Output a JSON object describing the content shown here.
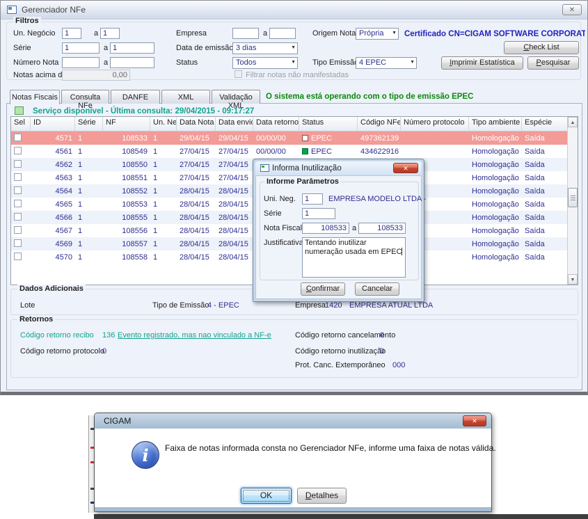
{
  "colors": {
    "teal_status": "#12a38f",
    "green_message": "#0b8a0b",
    "navy_value": "#2e2e90",
    "highlight_row_pink": "#f29b97",
    "certificate_blue": "#2222be",
    "status_green_box": "#00a550"
  },
  "main_window": {
    "title": "Gerenciador NFe",
    "filters": {
      "legend": "Filtros",
      "range_sep": "a",
      "un_negocio_label": "Un. Negócio",
      "un_negocio_from": "1",
      "un_negocio_to": "1",
      "serie_label": "Série",
      "serie_from": "1",
      "serie_to": "1",
      "numero_nota_label": "Número Nota",
      "numero_nota_from": "",
      "numero_nota_to": "",
      "notas_acima_label": "Notas acima de",
      "notas_acima_value": "0,00",
      "empresa_label": "Empresa",
      "empresa_from": "",
      "empresa_to": "",
      "data_emissao_label": "Data de emissão",
      "data_emissao_value": "3 dias",
      "status_label": "Status",
      "status_value": "Todos",
      "filtrar_label": "Filtrar notas não manifestadas",
      "origem_label": "Origem Nota",
      "origem_value": "Própria",
      "tipo_emissao_label": "Tipo Emissão",
      "tipo_emissao_value": "4 EPEC",
      "certificado": "Certificado CN=CIGAM SOFTWARE CORPORATIVI",
      "check_list_button": "Check List",
      "imprimir_button": "Imprimir Estatística",
      "pesquisar_button": "Pesquisar"
    },
    "tabs": {
      "items": [
        "Notas Fiscais",
        "Consulta NFe",
        "DANFE",
        "XML",
        "Validação XML"
      ],
      "active": "Notas Fiscais",
      "message": "O sistema está operando com o tipo de emissão EPEC"
    },
    "service_status": "Serviço disponível - Última consulta: 29/04/2015 - 09:17:27",
    "table": {
      "headers": [
        "Sel",
        "ID",
        "Série",
        "NF",
        "Un. Neg.",
        "Data Nota",
        "Data envio",
        "Data retorno",
        "Status",
        "Código NFe",
        "Número protocolo",
        "Tipo ambiente",
        "Espécie"
      ],
      "rows": [
        {
          "id": "4571",
          "serie": "1",
          "nf": "108533",
          "un_neg": "1",
          "data_nota": "29/04/15",
          "data_envio": "29/04/15",
          "data_retorno": "00/00/00",
          "status": "EPEC",
          "codigo_nfe": "497362139",
          "protocolo": "",
          "ambiente": "Homologação",
          "especie": "Saída"
        },
        {
          "id": "4561",
          "serie": "1",
          "nf": "108549",
          "un_neg": "1",
          "data_nota": "27/04/15",
          "data_envio": "27/04/15",
          "data_retorno": "00/00/00",
          "status": "EPEC",
          "codigo_nfe": "434622916",
          "protocolo": "",
          "ambiente": "Homologação",
          "especie": "Saída"
        },
        {
          "id": "4562",
          "serie": "1",
          "nf": "108550",
          "un_neg": "1",
          "data_nota": "27/04/15",
          "data_envio": "27/04/15",
          "data_retorno": "",
          "status": "",
          "codigo_nfe": "",
          "protocolo": "",
          "ambiente": "Homologação",
          "especie": "Saída"
        },
        {
          "id": "4563",
          "serie": "1",
          "nf": "108551",
          "un_neg": "1",
          "data_nota": "27/04/15",
          "data_envio": "27/04/15",
          "data_retorno": "",
          "status": "",
          "codigo_nfe": "",
          "protocolo": "",
          "ambiente": "Homologação",
          "especie": "Saída"
        },
        {
          "id": "4564",
          "serie": "1",
          "nf": "108552",
          "un_neg": "1",
          "data_nota": "28/04/15",
          "data_envio": "28/04/15",
          "data_retorno": "",
          "status": "",
          "codigo_nfe": "",
          "protocolo": "",
          "ambiente": "Homologação",
          "especie": "Saída"
        },
        {
          "id": "4565",
          "serie": "1",
          "nf": "108553",
          "un_neg": "1",
          "data_nota": "28/04/15",
          "data_envio": "28/04/15",
          "data_retorno": "",
          "status": "",
          "codigo_nfe": "",
          "protocolo": "",
          "ambiente": "Homologação",
          "especie": "Saída"
        },
        {
          "id": "4566",
          "serie": "1",
          "nf": "108555",
          "un_neg": "1",
          "data_nota": "28/04/15",
          "data_envio": "28/04/15",
          "data_retorno": "",
          "status": "",
          "codigo_nfe": "",
          "protocolo": "",
          "ambiente": "Homologação",
          "especie": "Saída"
        },
        {
          "id": "4567",
          "serie": "1",
          "nf": "108556",
          "un_neg": "1",
          "data_nota": "28/04/15",
          "data_envio": "28/04/15",
          "data_retorno": "",
          "status": "",
          "codigo_nfe": "",
          "protocolo": "",
          "ambiente": "Homologação",
          "especie": "Saída"
        },
        {
          "id": "4569",
          "serie": "1",
          "nf": "108557",
          "un_neg": "1",
          "data_nota": "28/04/15",
          "data_envio": "28/04/15",
          "data_retorno": "",
          "status": "",
          "codigo_nfe": "",
          "protocolo": "",
          "ambiente": "Homologação",
          "especie": "Saída"
        },
        {
          "id": "4570",
          "serie": "1",
          "nf": "108558",
          "un_neg": "1",
          "data_nota": "28/04/15",
          "data_envio": "28/04/15",
          "data_retorno": "",
          "status": "",
          "codigo_nfe": "",
          "protocolo": "",
          "ambiente": "Homologação",
          "especie": "Saída"
        }
      ]
    },
    "dados_adicionais": {
      "legend": "Dados Adicionais",
      "lote_label": "Lote",
      "tipo_emissao_label": "Tipo de Emissão",
      "tipo_emissao_value": "4 - EPEC",
      "empresa_label": "Empresa",
      "empresa_code": "1420",
      "empresa_name": "EMPRESA ATUAL LTDA"
    },
    "retornos": {
      "legend": "Retornos",
      "recibo_label": "Código retorno recibo",
      "recibo_code": "136",
      "recibo_link": "Evento registrado, mas nao vinculado a NF-e",
      "protocolo_label": "Código retorno protocolo",
      "protocolo_value": "0",
      "cancelamento_label": "Código retorno cancelamento",
      "cancelamento_value": "0",
      "inutilizacao_label": "Código retorno inutilização",
      "inutilizacao_value": "0",
      "prot_canc_label": "Prot. Canc. Extemporâneo",
      "prot_canc_value": "000"
    }
  },
  "inutilizacao_dialog": {
    "title": "Informa Inutilização",
    "group_legend": "Informe Parâmetros",
    "uni_neg_label": "Uni. Neg.",
    "uni_neg_value": "1",
    "uni_neg_name": "EMPRESA MODELO LTDA -",
    "serie_label": "Série",
    "serie_value": "1",
    "nota_fiscal_label": "Nota Fiscal",
    "nota_from": "108533",
    "range_sep": "a",
    "nota_to": "108533",
    "justificativa_label": "Justificativa",
    "justificativa_value": "Tentando inutilizar numeração usada em EPEC",
    "confirmar_button": "Confirmar",
    "cancelar_button": "Cancelar"
  },
  "cigam_dialog": {
    "title": "CIGAM",
    "message": "Faixa de notas informada consta no Gerenciador NFe, informe uma faixa de notas válida.",
    "ok_button": "OK",
    "detalhes_button": "Detalhes"
  }
}
